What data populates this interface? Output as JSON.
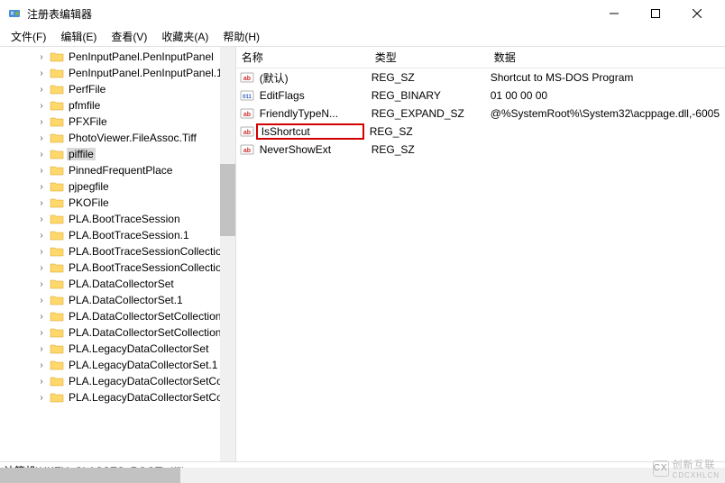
{
  "window": {
    "title": "注册表编辑器"
  },
  "menu": {
    "file": "文件(F)",
    "edit": "编辑(E)",
    "view": "查看(V)",
    "fav": "收藏夹(A)",
    "help": "帮助(H)"
  },
  "tree": {
    "items": [
      {
        "label": "PenInputPanel.PenInputPanel"
      },
      {
        "label": "PenInputPanel.PenInputPanel.1"
      },
      {
        "label": "PerfFile"
      },
      {
        "label": "pfmfile"
      },
      {
        "label": "PFXFile"
      },
      {
        "label": "PhotoViewer.FileAssoc.Tiff"
      },
      {
        "label": "piffile",
        "selected": true
      },
      {
        "label": "PinnedFrequentPlace"
      },
      {
        "label": "pjpegfile"
      },
      {
        "label": "PKOFile"
      },
      {
        "label": "PLA.BootTraceSession"
      },
      {
        "label": "PLA.BootTraceSession.1"
      },
      {
        "label": "PLA.BootTraceSessionCollectio"
      },
      {
        "label": "PLA.BootTraceSessionCollectio"
      },
      {
        "label": "PLA.DataCollectorSet"
      },
      {
        "label": "PLA.DataCollectorSet.1"
      },
      {
        "label": "PLA.DataCollectorSetCollection"
      },
      {
        "label": "PLA.DataCollectorSetCollection"
      },
      {
        "label": "PLA.LegacyDataCollectorSet"
      },
      {
        "label": "PLA.LegacyDataCollectorSet.1"
      },
      {
        "label": "PLA.LegacyDataCollectorSetCo"
      },
      {
        "label": "PLA.LegacyDataCollectorSetCo"
      }
    ]
  },
  "list": {
    "headers": {
      "name": "名称",
      "type": "类型",
      "data": "数据"
    },
    "rows": [
      {
        "icon": "str",
        "name": "(默认)",
        "type": "REG_SZ",
        "data": "Shortcut to MS-DOS Program"
      },
      {
        "icon": "bin",
        "name": "EditFlags",
        "type": "REG_BINARY",
        "data": "01 00 00 00"
      },
      {
        "icon": "str",
        "name": "FriendlyTypeN...",
        "type": "REG_EXPAND_SZ",
        "data": "@%SystemRoot%\\System32\\acppage.dll,-6005"
      },
      {
        "icon": "str",
        "name": "IsShortcut",
        "type": "REG_SZ",
        "data": "",
        "hl": true
      },
      {
        "icon": "str",
        "name": "NeverShowExt",
        "type": "REG_SZ",
        "data": ""
      }
    ]
  },
  "status": {
    "path": "计算机\\HKEY_CLASSES_ROOT\\piffile"
  },
  "watermark": {
    "text": "创新互联",
    "sub": "CDCXHLCN"
  }
}
